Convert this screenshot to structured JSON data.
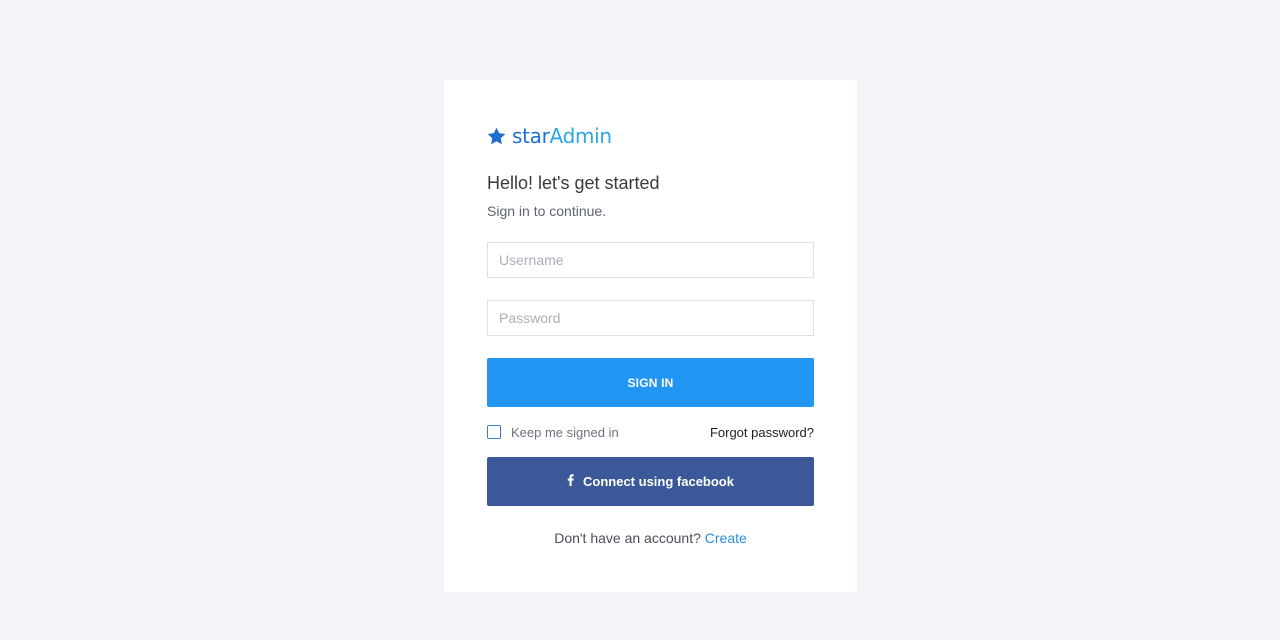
{
  "brand": {
    "part1": "star",
    "part2": "Admin",
    "icon": "star-icon",
    "color_primary": "#1e6fd0",
    "color_secondary": "#2aa7e8"
  },
  "heading": "Hello! let's get started",
  "subheading": "Sign in to continue.",
  "form": {
    "username_placeholder": "Username",
    "username_value": "",
    "password_placeholder": "Password",
    "password_value": "",
    "signin_label": "SIGN IN",
    "keep_signed_in_label": "Keep me signed in",
    "keep_signed_in_checked": false,
    "forgot_password_label": "Forgot password?",
    "facebook_icon": "facebook-icon",
    "facebook_label": "Connect using facebook"
  },
  "signup": {
    "prompt": "Don't have an account? ",
    "link_label": "Create"
  },
  "colors": {
    "background": "#f2f4f8",
    "signin_button": "#2196f3",
    "facebook_button": "#3b5998"
  }
}
